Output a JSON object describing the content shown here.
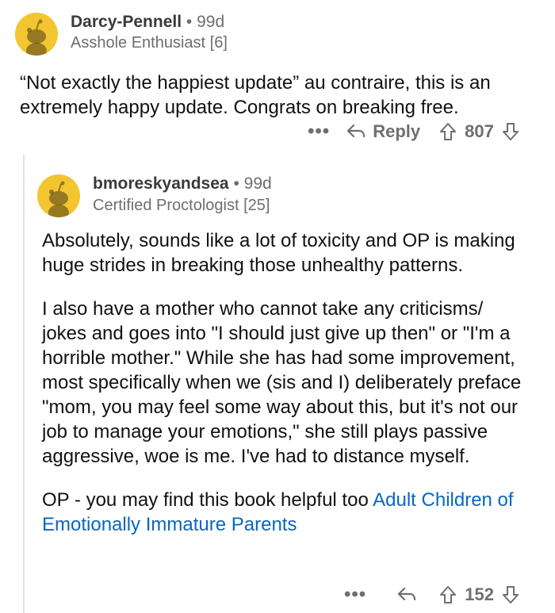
{
  "comment1": {
    "username": "Darcy-Pennell",
    "separator": "•",
    "age": "99d",
    "flair": "Asshole Enthusiast [6]",
    "body": "“Not exactly the happiest update” au contraire, this is an extremely happy update. Congrats on breaking free.",
    "more": "•••",
    "reply_label": "Reply",
    "score": "807"
  },
  "comment2": {
    "username": "bmoreskyandsea",
    "separator": "•",
    "age": "99d",
    "flair": "Certified Proctologist [25]",
    "paragraph1": "Absolutely, sounds like a lot of toxicity and OP is making huge strides in breaking those unhealthy patterns.",
    "paragraph2": "I also have a mother who cannot take any criticisms/ jokes and goes into \"I should just give up then\" or \"I'm a horrible mother.\" While she has had some improvement, most specifically when we (sis and I) deliberately preface \"mom, you may feel some way about this, but it's not our job to manage your emotions,\" she still plays passive aggressive, woe is me. I've had to distance myself.",
    "paragraph3_prefix": "OP - you may find this book helpful too ",
    "link_text": "Adult Children of Emotionally Immature Parents",
    "more": "•••",
    "score": "152"
  },
  "colors": {
    "avatar_bg": "#f2c531",
    "link": "#0a66c2",
    "meta_gray": "#6e6e73"
  },
  "icons": [
    "snoo-avatar-icon",
    "reply-arrow-icon",
    "upvote-icon",
    "downvote-icon"
  ]
}
